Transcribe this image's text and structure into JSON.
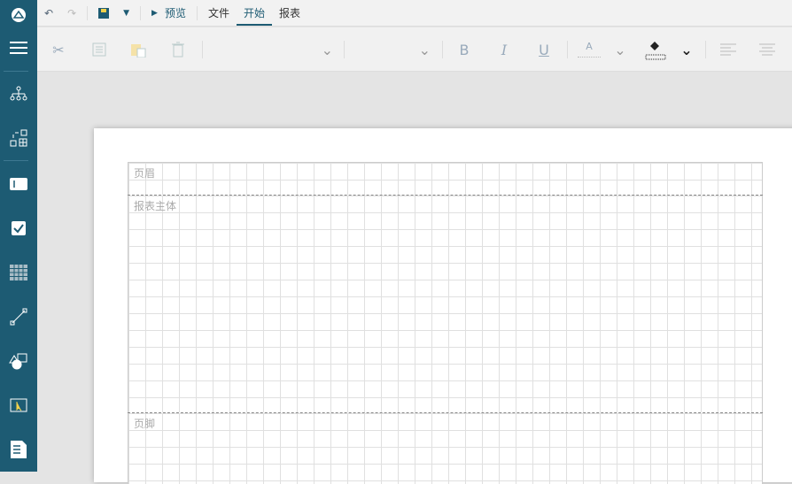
{
  "topbar": {
    "preview": "预览",
    "tabs": [
      {
        "label": "文件"
      },
      {
        "label": "开始"
      },
      {
        "label": "报表"
      }
    ]
  },
  "ribbon": {
    "bold": "B",
    "italic": "I",
    "underline": "U",
    "font_color": "A"
  },
  "report": {
    "header_label": "页眉",
    "body_label": "报表主体",
    "footer_label": "页脚"
  },
  "colors": {
    "sidebar": "#1d5b73",
    "accent": "#1d5b73"
  }
}
